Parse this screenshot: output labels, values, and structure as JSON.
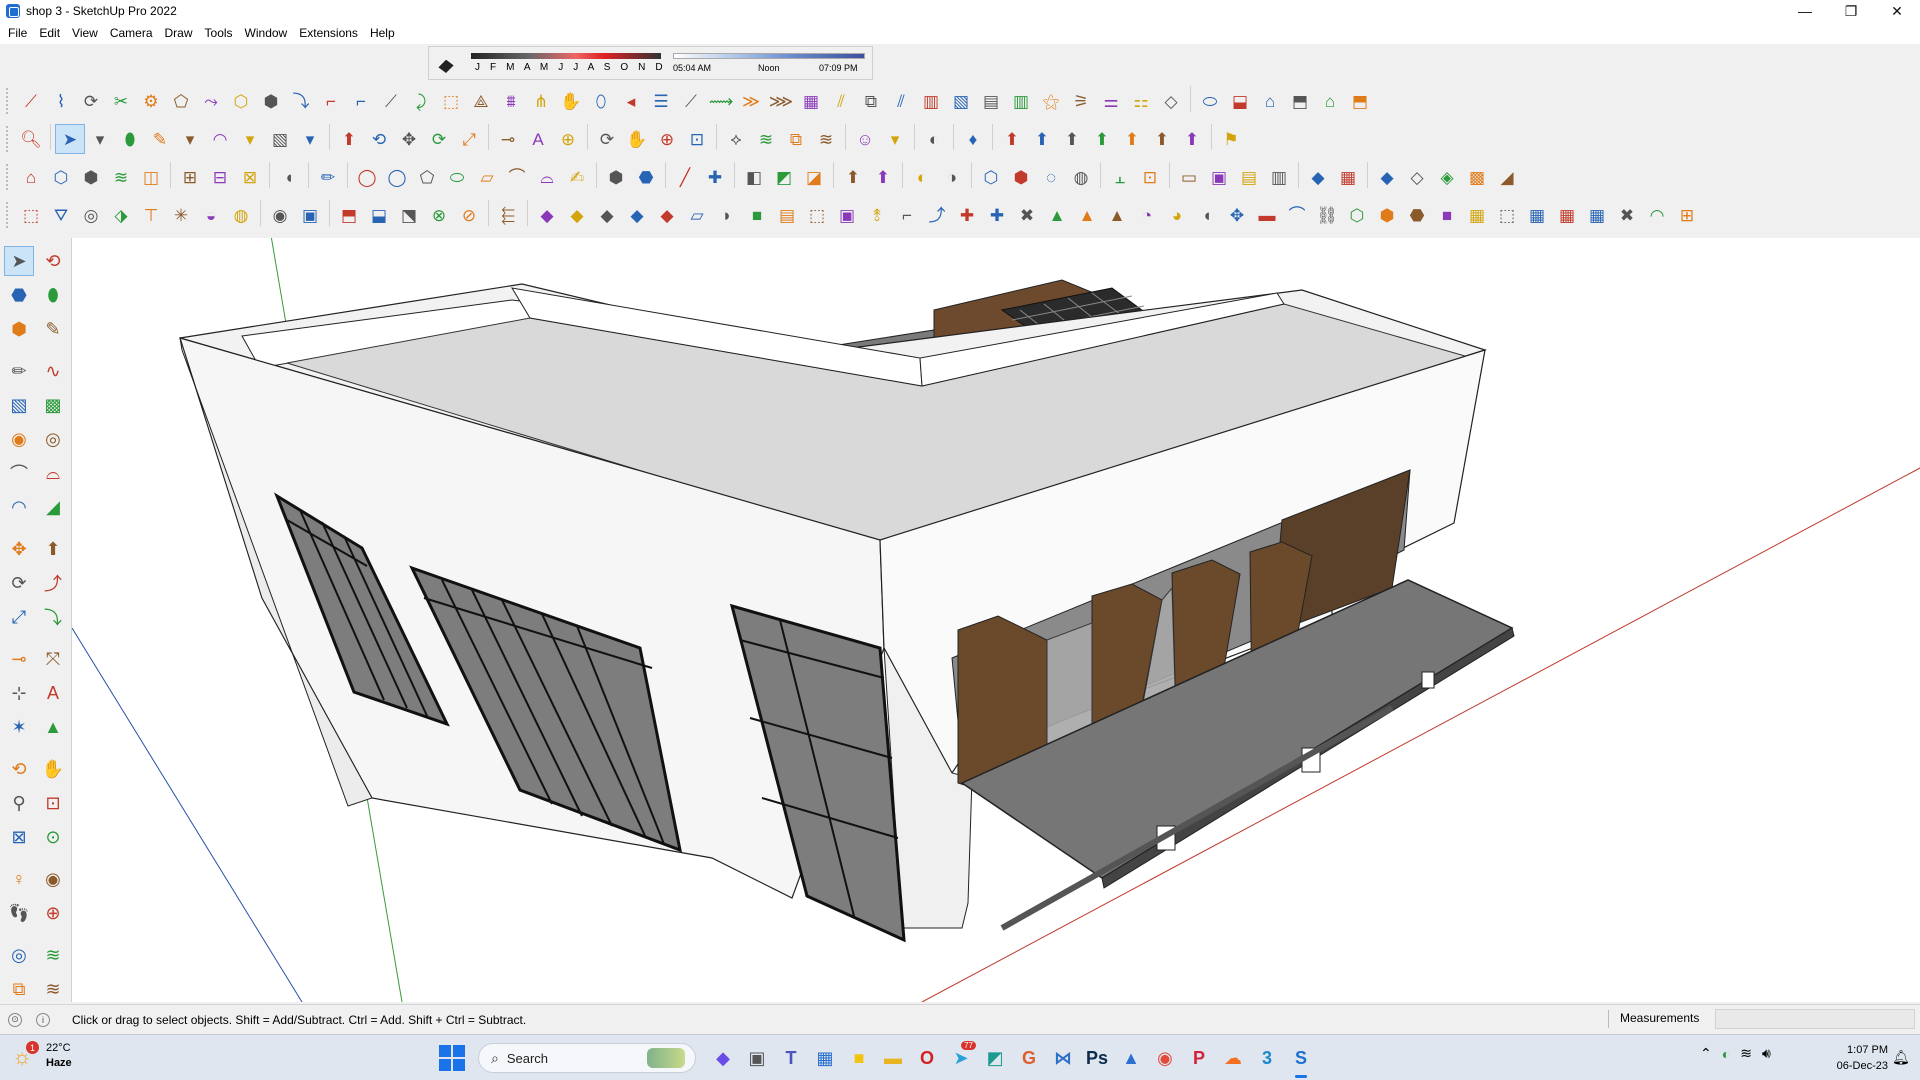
{
  "window": {
    "title": "shop 3 - SketchUp Pro 2022",
    "controls": {
      "minimize": "—",
      "maximize": "❐",
      "close": "✕"
    }
  },
  "menu": [
    "File",
    "Edit",
    "View",
    "Camera",
    "Draw",
    "Tools",
    "Window",
    "Extensions",
    "Help"
  ],
  "shadows": {
    "months": "J F M A M J J A S O N D",
    "sunrise": "05:04 AM",
    "noon": "Noon",
    "sunset": "07:09 PM"
  },
  "status": {
    "hint": "Click or drag to select objects. Shift = Add/Subtract. Ctrl = Add. Shift + Ctrl = Subtract.",
    "measurements_label": "Measurements",
    "measurements_value": ""
  },
  "taskbar": {
    "weather_temp": "22°C",
    "weather_desc": "Haze",
    "weather_badge": "1",
    "search_label": "Search",
    "time": "1:07 PM",
    "date": "06-Dec-23",
    "apps": [
      {
        "icon": "copilot-icon",
        "glyph": "◆"
      },
      {
        "icon": "task-view-icon",
        "glyph": "▣"
      },
      {
        "icon": "teams-icon",
        "glyph": "T"
      },
      {
        "icon": "calculator-icon",
        "glyph": "▦"
      },
      {
        "icon": "sticky-notes-icon",
        "glyph": "■"
      },
      {
        "icon": "file-explorer-icon",
        "glyph": "▬"
      },
      {
        "icon": "opera-icon",
        "glyph": "O"
      },
      {
        "icon": "telegram-icon",
        "glyph": "➤"
      },
      {
        "icon": "maps-icon",
        "glyph": "◩"
      },
      {
        "icon": "grammarly-icon",
        "glyph": "G"
      },
      {
        "icon": "visual-studio-icon",
        "glyph": "⋈"
      },
      {
        "icon": "photoshop-icon",
        "glyph": "Ps"
      },
      {
        "icon": "autodesk-icon",
        "glyph": "▲"
      },
      {
        "icon": "chrome-icon",
        "glyph": "◉"
      },
      {
        "icon": "pinterest-icon",
        "glyph": "P"
      },
      {
        "icon": "soundcloud-icon",
        "glyph": "☁"
      },
      {
        "icon": "calculator-app-icon",
        "glyph": "3"
      },
      {
        "icon": "sketchup-icon",
        "glyph": "S"
      }
    ],
    "apps_badges": {
      "teams-icon": "",
      "telegram-icon": "77"
    }
  },
  "colors": {
    "selection": "#cce4f7",
    "wall": "#ffffff",
    "glass": "#8a8a8a",
    "wood": "#6b4a2b",
    "axis_red": "#c0392b",
    "axis_green": "#3a9a3a",
    "axis_blue": "#2a4fa8"
  }
}
